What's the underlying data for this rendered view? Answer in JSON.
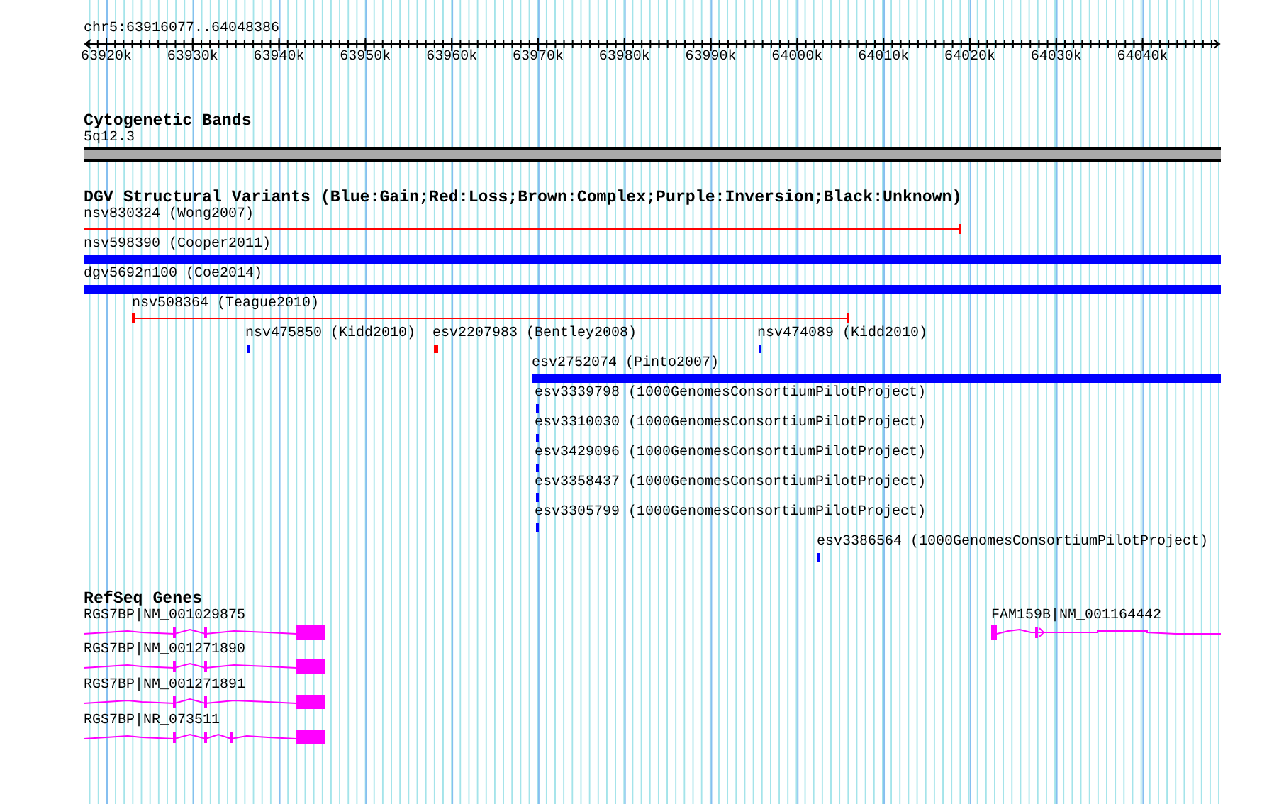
{
  "ruler": {
    "region": "chr5:63916077..64048386",
    "ticks": [
      "63920k",
      "63930k",
      "63940k",
      "63950k",
      "63960k",
      "63970k",
      "63980k",
      "63990k",
      "64000k",
      "64010k",
      "64020k",
      "64030k",
      "64040k"
    ]
  },
  "tracks": [
    {
      "kind": "bands",
      "title": "Cytogenetic Bands",
      "features": [
        {
          "label": "5q12.3"
        }
      ]
    },
    {
      "kind": "variants",
      "title": "DGV Structural Variants (Blue:Gain;Red:Loss;Brown:Complex;Purple:Inversion;Black:Unknown)",
      "features": [
        {
          "label": "nsv830324 (Wong2007)",
          "color": "#ff0000"
        },
        {
          "label": "nsv598390 (Cooper2011)",
          "color": "#0000ff"
        },
        {
          "label": "dgv5692n100 (Coe2014)",
          "color": "#0000ff"
        },
        {
          "label": "nsv508364 (Teague2010)",
          "color": "#ff0000"
        },
        {
          "label": "nsv475850 (Kidd2010)",
          "color": "#0000ff"
        },
        {
          "label": "esv2207983 (Bentley2008)",
          "color": "#ff0000"
        },
        {
          "label": "nsv474089 (Kidd2010)",
          "color": "#0000ff"
        },
        {
          "label": "esv2752074 (Pinto2007)",
          "color": "#0000ff"
        },
        {
          "label": "esv3339798 (1000GenomesConsortiumPilotProject)",
          "color": "#0000ff"
        },
        {
          "label": "esv3310030 (1000GenomesConsortiumPilotProject)",
          "color": "#0000ff"
        },
        {
          "label": "esv3429096 (1000GenomesConsortiumPilotProject)",
          "color": "#0000ff"
        },
        {
          "label": "esv3358437 (1000GenomesConsortiumPilotProject)",
          "color": "#0000ff"
        },
        {
          "label": "esv3305799 (1000GenomesConsortiumPilotProject)",
          "color": "#0000ff"
        },
        {
          "label": "esv3386564 (1000GenomesConsortiumPilotProject)",
          "color": "#0000ff"
        }
      ]
    },
    {
      "kind": "genes",
      "title": "RefSeq Genes",
      "features": [
        {
          "label": "RGS7BP|NM_001029875"
        },
        {
          "label": "RGS7BP|NM_001271890"
        },
        {
          "label": "RGS7BP|NM_001271891"
        },
        {
          "label": "RGS7BP|NR_073511"
        },
        {
          "label": "FAM159B|NM_001164442"
        }
      ]
    }
  ]
}
